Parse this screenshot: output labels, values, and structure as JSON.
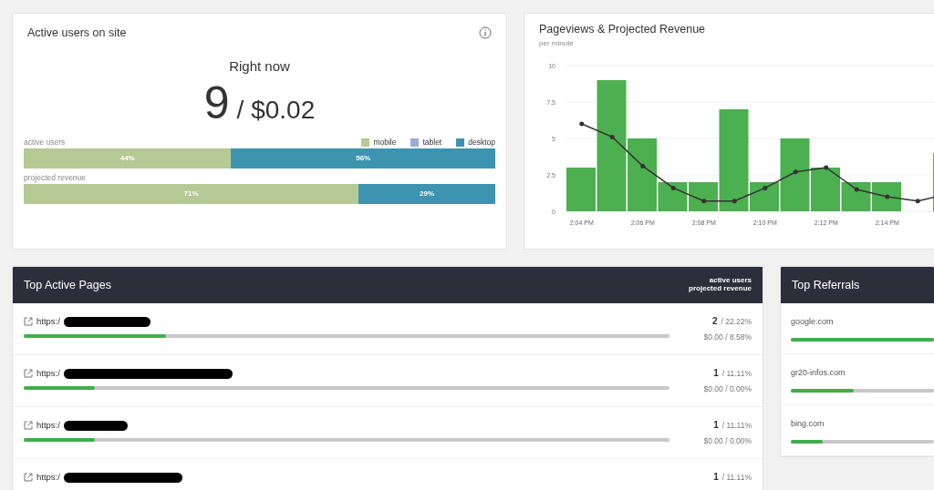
{
  "active_users_card": {
    "title": "Active users on site",
    "subtitle": "Right now",
    "count": "9",
    "revenue": "/ $0.02",
    "legend": [
      {
        "label": "mobile",
        "color": "#b5c994"
      },
      {
        "label": "tablet",
        "color": "#98aed8"
      },
      {
        "label": "desktop",
        "color": "#3d94b0"
      }
    ],
    "bars": [
      {
        "label": "active users",
        "level": 0.44,
        "segments": [
          {
            "label": "44%",
            "color": "#b5c994"
          },
          {
            "label": "56%",
            "color": "#3d94b0"
          }
        ]
      },
      {
        "label": "projected revenue",
        "level": 0.71,
        "segments": [
          {
            "label": "71%",
            "color": "#b5c994"
          },
          {
            "label": "29%",
            "color": "#3d94b0"
          }
        ]
      }
    ]
  },
  "pageviews_card": {
    "title": "Pageviews & Projected Revenue",
    "subtitle": "per minute",
    "chart_data": {
      "type": "bar",
      "categories": [
        "2:04 PM",
        null,
        "2:06 PM",
        null,
        "2:08 PM",
        null,
        "2:10 PM",
        null,
        "2:12 PM",
        null,
        "2:14 PM",
        null,
        null
      ],
      "series": [
        {
          "color": "#4caf50",
          "values": [
            3,
            9,
            5,
            2,
            2,
            7,
            2,
            5,
            3,
            2,
            2,
            0,
            4
          ]
        },
        {
          "type": "line",
          "color": "#333333",
          "values": [
            6,
            5.1,
            3.1,
            1.6,
            0.7,
            0.7,
            1.6,
            2.7,
            3,
            1.5,
            1,
            0.7,
            1.2
          ]
        }
      ],
      "grid": true,
      "ylim": [
        0,
        10
      ],
      "yticks": [
        0,
        {
          "value": 2.5,
          "label": "2.5"
        },
        {
          "value": 5,
          "label": "5"
        },
        {
          "value": 7.5,
          "label": "7.5"
        },
        {
          "value": 10,
          "label": "10"
        }
      ]
    }
  },
  "top_pages": {
    "title": "Top Active Pages",
    "header_right": [
      "active users",
      "projected revenue"
    ],
    "rows": [
      {
        "url": "https:/",
        "level": 0.22,
        "users": "2",
        "users_share": "/ 22.22%",
        "revenue": "$0.00 / 8.58%"
      },
      {
        "url": "https:/",
        "level": 0.11,
        "users": "1",
        "users_share": "/ 11.11%",
        "revenue": "$0.00 / 0.00%"
      },
      {
        "url": "https:/",
        "level": 0.11,
        "users": "1",
        "users_share": "/ 11.11%",
        "revenue": "$0.00 / 0.00%"
      },
      {
        "url": "https:/",
        "users": "1",
        "users_share": "/ 11.11%"
      }
    ]
  },
  "top_referrals": {
    "title": "Top Referrals",
    "rows": [
      {
        "label": "google.com",
        "level": 1
      },
      {
        "label": "gr20-infos.com",
        "level": 0.44
      },
      {
        "label": "bing.com",
        "level": 0.22
      }
    ]
  }
}
